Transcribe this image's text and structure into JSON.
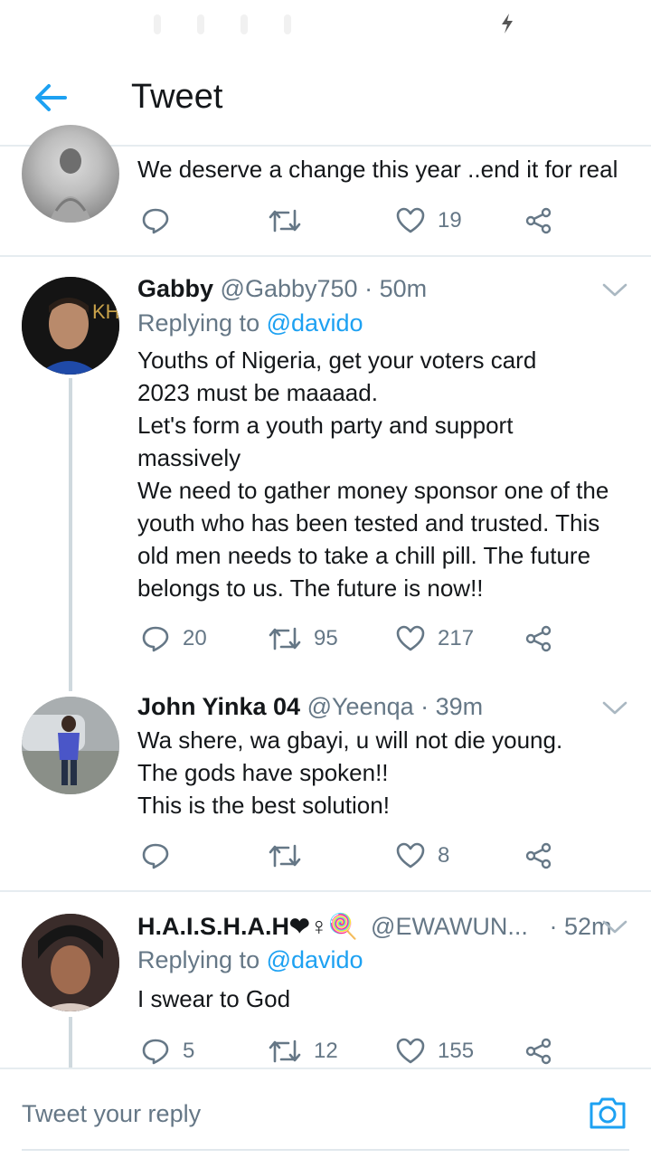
{
  "header": {
    "title": "Tweet"
  },
  "tweets": [
    {
      "name": "",
      "handle": "",
      "time": "",
      "text": "We deserve a change this year ..end it for real",
      "replies": "",
      "retweets": "",
      "likes": "19"
    },
    {
      "name": "Gabby",
      "handle": "@Gabby750",
      "time": "· 50m",
      "replying_prefix": "Replying to ",
      "replying_to": "@davido",
      "text_lines": [
        "Youths of Nigeria, get your voters card",
        "2023 must be maaaad.",
        "Let's form a youth party and support",
        "massively",
        "We need to gather money sponsor one of the",
        "youth who has been tested and trusted. This",
        "old men needs to take a chill pill. The future",
        "belongs to us. The future is now!!"
      ],
      "replies": "20",
      "retweets": "95",
      "likes": "217"
    },
    {
      "name": "John Yinka 04",
      "handle": "@Yeenqa",
      "time": "· 39m",
      "text_lines": [
        "Wa shere, wa gbayi, u will not die young.",
        "The gods have spoken!!",
        "This is the best solution!"
      ],
      "replies": "",
      "retweets": "",
      "likes": "8"
    },
    {
      "name": "H.A.I.S.H.A.H❤♀🍭",
      "handle": "@EWAWUN...",
      "time": "· 52m",
      "replying_prefix": "Replying to ",
      "replying_to": "@davido",
      "text": "I swear to God",
      "replies": "5",
      "retweets": "12",
      "likes": "155"
    }
  ],
  "reply_bar": {
    "placeholder": "Tweet your reply"
  },
  "colors": {
    "accent": "#1da1f2",
    "text_primary": "#14171a",
    "text_secondary": "#657786",
    "divider": "#e6ecf0"
  },
  "icons": [
    "back-arrow-icon",
    "lightning-icon",
    "reply-icon",
    "retweet-icon",
    "like-icon",
    "share-icon",
    "chevron-down-icon",
    "camera-icon"
  ]
}
